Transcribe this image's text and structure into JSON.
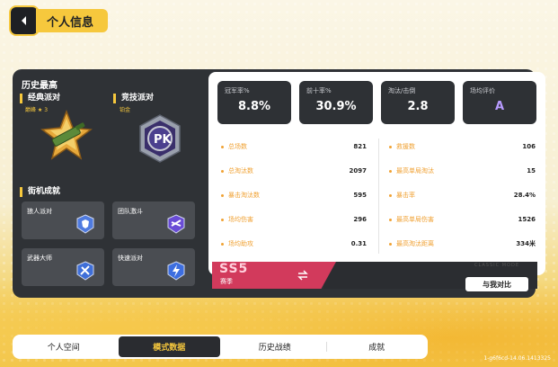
{
  "header": {
    "title": "个人信息"
  },
  "history": {
    "title": "历史最高",
    "classic": {
      "label": "经典派对",
      "rank": "巅峰 ★ 3"
    },
    "competitive": {
      "label": "竞技派对",
      "rank": "铂金"
    },
    "arcade_title": "街机成就",
    "arcade": [
      {
        "label": "狼人派对"
      },
      {
        "label": "团队激斗"
      },
      {
        "label": "武器大师"
      },
      {
        "label": "快速派对"
      }
    ]
  },
  "stats_boxes": [
    {
      "title": "冠军率%",
      "value": "8.8%"
    },
    {
      "title": "前十率%",
      "value": "30.9%"
    },
    {
      "title": "淘汰/击倒",
      "value": "2.8"
    },
    {
      "title": "场均评价",
      "value": "A"
    }
  ],
  "left_stats": [
    {
      "label": "总场数",
      "value": "821"
    },
    {
      "label": "总淘汰数",
      "value": "2097"
    },
    {
      "label": "暴击淘汰数",
      "value": "595"
    },
    {
      "label": "场均伤害",
      "value": "296"
    },
    {
      "label": "场均助攻",
      "value": "0.31"
    }
  ],
  "right_stats": [
    {
      "label": "救援数",
      "value": "106"
    },
    {
      "label": "最高单局淘汰",
      "value": "15"
    },
    {
      "label": "暴击率",
      "value": "28.4%"
    },
    {
      "label": "最高单局伤害",
      "value": "1526"
    },
    {
      "label": "最高淘汰距离",
      "value": "334米"
    }
  ],
  "season": {
    "code": "SS5",
    "label": "赛季",
    "deco": "CLASSIC MODE"
  },
  "compare_button": "与我对比",
  "tabs": [
    {
      "label": "个人空间",
      "active": false
    },
    {
      "label": "模式数据",
      "active": true
    },
    {
      "label": "历史战绩",
      "active": false
    },
    {
      "label": "成就",
      "active": false
    }
  ],
  "version": "1-g6f6cd-14.06.1413325",
  "colors": {
    "accent": "#f6c83d",
    "panel": "#2f3236",
    "stat_label": "#f0a234",
    "season": "#d23a5c",
    "grade": "#b89bff"
  }
}
